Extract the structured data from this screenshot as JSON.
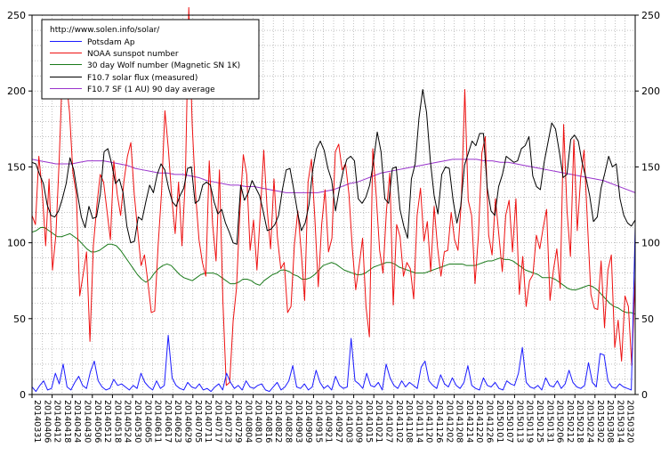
{
  "chart_data": {
    "type": "line",
    "ylim": [
      0,
      250
    ],
    "yticks": [
      0,
      50,
      100,
      150,
      200,
      250
    ],
    "grid": true,
    "legend_position": "top-left",
    "x_tick_labels": [
      "20140331",
      "20140412",
      "20140424",
      "20140506",
      "20140518",
      "20140530",
      "20140611",
      "20140623",
      "20140705",
      "20140717",
      "20140729",
      "20140810",
      "20140822",
      "20140903",
      "20140915",
      "20140927",
      "20141009",
      "20141021",
      "20141102",
      "20141114",
      "20141126",
      "20141208",
      "20141220",
      "20150101",
      "20150113",
      "20150125",
      "20150206",
      "20150218",
      "20150302",
      "20150314"
    ],
    "x_tick_labels_alt": [
      "20140406",
      "20140418",
      "20140430",
      "20140512",
      "20140524",
      "20140605",
      "20140617",
      "20140629",
      "20140711",
      "20140723",
      "20140804",
      "20140816",
      "20140828",
      "20140909",
      "20140921",
      "20141003",
      "20141015",
      "20141027",
      "20141108",
      "20141120",
      "20141202",
      "20141214",
      "20141226",
      "20150107",
      "20150119",
      "20150131",
      "20150212",
      "20150224",
      "20150308",
      "20150320"
    ],
    "legend_source": "http://www.solen.info/solar/",
    "series": [
      {
        "name": "Potsdam Ap",
        "color": "#1a1aff",
        "values": [
          5,
          2,
          6,
          9,
          3,
          4,
          14,
          7,
          20,
          5,
          3,
          8,
          12,
          6,
          4,
          15,
          22,
          9,
          5,
          3,
          4,
          10,
          6,
          7,
          5,
          3,
          6,
          4,
          14,
          8,
          5,
          3,
          9,
          4,
          6,
          39,
          11,
          6,
          4,
          3,
          8,
          5,
          4,
          7,
          3,
          4,
          2,
          5,
          7,
          3,
          14,
          8,
          4,
          6,
          3,
          9,
          5,
          4,
          6,
          7,
          3,
          2,
          5,
          8,
          3,
          5,
          9,
          19,
          5,
          4,
          7,
          3,
          5,
          16,
          8,
          4,
          6,
          3,
          12,
          6,
          4,
          5,
          37,
          9,
          7,
          4,
          14,
          6,
          5,
          8,
          3,
          20,
          11,
          6,
          4,
          9,
          5,
          8,
          6,
          4,
          18,
          22,
          9,
          6,
          4,
          13,
          7,
          5,
          11,
          6,
          4,
          8,
          19,
          6,
          4,
          3,
          11,
          6,
          5,
          8,
          4,
          3,
          9,
          7,
          6,
          14,
          31,
          8,
          5,
          4,
          6,
          3,
          11,
          6,
          5,
          9,
          4,
          7,
          16,
          8,
          5,
          4,
          6,
          21,
          8,
          5,
          27,
          26,
          9,
          5,
          4,
          7,
          5,
          4,
          3,
          110
        ]
      },
      {
        "name": "NOAA sunspot number",
        "color": "#ee1111",
        "values": [
          118,
          112,
          157,
          134,
          98,
          142,
          82,
          105,
          156,
          220,
          208,
          186,
          146,
          132,
          65,
          79,
          94,
          35,
          98,
          124,
          145,
          140,
          121,
          102,
          154,
          132,
          118,
          141,
          157,
          166,
          132,
          108,
          85,
          92,
          74,
          54,
          55,
          98,
          133,
          187,
          162,
          130,
          106,
          140,
          98,
          142,
          255,
          178,
          132,
          102,
          87,
          78,
          154,
          112,
          88,
          148,
          62,
          6,
          8,
          48,
          70,
          121,
          158,
          145,
          95,
          115,
          82,
          120,
          161,
          122,
          96,
          142,
          104,
          83,
          87,
          54,
          58,
          99,
          121,
          94,
          62,
          140,
          155,
          116,
          71,
          112,
          135,
          94,
          103,
          160,
          165,
          148,
          152,
          132,
          96,
          69,
          85,
          103,
          58,
          38,
          162,
          131,
          95,
          80,
          121,
          146,
          59,
          112,
          104,
          78,
          87,
          83,
          63,
          118,
          136,
          101,
          114,
          81,
          124,
          97,
          78,
          94,
          95,
          120,
          102,
          95,
          128,
          201,
          128,
          118,
          73,
          105,
          159,
          170,
          105,
          92,
          129,
          105,
          81,
          118,
          128,
          94,
          129,
          66,
          91,
          58,
          75,
          79,
          105,
          96,
          110,
          122,
          62,
          82,
          96,
          70,
          178,
          121,
          91,
          168,
          108,
          143,
          161,
          113,
          66,
          57,
          56,
          88,
          44,
          82,
          92,
          31,
          49,
          22,
          65,
          58,
          19,
          78
        ]
      },
      {
        "name": "30 day Wolf number (Magnetic SN 1K)",
        "color": "#1a7a1a",
        "values": [
          107,
          108,
          110,
          110,
          108,
          106,
          104,
          104,
          105,
          106,
          104,
          102,
          99,
          96,
          94,
          94,
          95,
          97,
          99,
          99,
          98,
          95,
          91,
          87,
          83,
          79,
          76,
          74,
          76,
          80,
          83,
          85,
          86,
          85,
          82,
          79,
          77,
          76,
          75,
          77,
          79,
          80,
          80,
          80,
          79,
          77,
          75,
          73,
          73,
          74,
          76,
          76,
          75,
          73,
          72,
          75,
          77,
          79,
          80,
          82,
          82,
          81,
          79,
          78,
          76,
          76,
          77,
          79,
          82,
          85,
          86,
          87,
          86,
          84,
          82,
          81,
          80,
          79,
          79,
          80,
          82,
          84,
          85,
          86,
          87,
          87,
          86,
          84,
          83,
          82,
          81,
          80,
          80,
          80,
          81,
          82,
          83,
          84,
          85,
          86,
          86,
          86,
          86,
          85,
          85,
          85,
          86,
          87,
          88,
          88,
          89,
          90,
          89,
          89,
          88,
          86,
          84,
          82,
          81,
          80,
          79,
          77,
          77,
          77,
          76,
          74,
          72,
          70,
          69,
          69,
          70,
          71,
          72,
          71,
          69,
          66,
          63,
          60,
          58,
          57,
          55,
          54,
          54,
          53
        ]
      },
      {
        "name": "F10.7 solar flux (measured)",
        "color": "#000000",
        "values": [
          153,
          152,
          145,
          139,
          125,
          118,
          117,
          121,
          129,
          139,
          156,
          148,
          132,
          117,
          110,
          124,
          116,
          117,
          132,
          160,
          162,
          152,
          139,
          142,
          133,
          111,
          100,
          101,
          117,
          115,
          127,
          138,
          133,
          145,
          152,
          148,
          136,
          127,
          124,
          131,
          136,
          149,
          150,
          126,
          128,
          138,
          140,
          138,
          127,
          119,
          122,
          113,
          107,
          100,
          99,
          138,
          128,
          133,
          141,
          136,
          131,
          120,
          108,
          109,
          112,
          118,
          135,
          148,
          149,
          135,
          120,
          108,
          113,
          125,
          148,
          162,
          167,
          161,
          149,
          141,
          121,
          135,
          147,
          155,
          157,
          154,
          129,
          126,
          130,
          138,
          153,
          173,
          160,
          129,
          126,
          149,
          150,
          122,
          111,
          103,
          142,
          152,
          182,
          201,
          186,
          154,
          131,
          119,
          145,
          150,
          149,
          128,
          113,
          124,
          151,
          159,
          167,
          164,
          172,
          172,
          136,
          121,
          118,
          137,
          145,
          157,
          155,
          153,
          154,
          162,
          164,
          170,
          144,
          137,
          135,
          153,
          166,
          179,
          175,
          160,
          143,
          145,
          168,
          171,
          167,
          153,
          143,
          131,
          114,
          117,
          136,
          146,
          157,
          150,
          152,
          129,
          118,
          113,
          111,
          115
        ]
      },
      {
        "name": "F10.7 SF (1 AU) 90 day average",
        "color": "#9933cc",
        "values": [
          155,
          154,
          153,
          152,
          152,
          152,
          153,
          154,
          154,
          154,
          153,
          152,
          151,
          149,
          148,
          147,
          146,
          146,
          145,
          145,
          144,
          143,
          141,
          140,
          139,
          138,
          138,
          137,
          137,
          136,
          135,
          134,
          133,
          133,
          133,
          133,
          133,
          134,
          135,
          137,
          139,
          140,
          142,
          144,
          146,
          147,
          148,
          149,
          150,
          151,
          152,
          153,
          154,
          155,
          155,
          155,
          155,
          154,
          154,
          153,
          153,
          152,
          151,
          150,
          149,
          148,
          147,
          146,
          145,
          144,
          143,
          142,
          141,
          139,
          137,
          135,
          133
        ]
      }
    ]
  }
}
